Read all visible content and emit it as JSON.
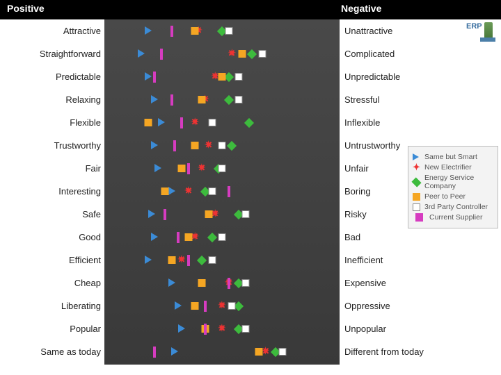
{
  "header": {
    "positive": "Positive",
    "negative": "Negative"
  },
  "logo": {
    "text": "ERP"
  },
  "axis_ticks": [
    "0.2",
    "0.3",
    "0.4",
    "0.5",
    "0.6",
    "0.7",
    "0.8"
  ],
  "legend": {
    "items": [
      {
        "key": "same_but_smart",
        "label": "Same but Smart"
      },
      {
        "key": "new_electrifier",
        "label": "New Electrifier"
      },
      {
        "key": "energy_service_company",
        "label": "Energy Service Company"
      },
      {
        "key": "peer_to_peer",
        "label": "Peer to Peer"
      },
      {
        "key": "third_party_controller",
        "label": "3rd Party Controller"
      },
      {
        "key": "current_supplier",
        "label": "Current Supplier"
      }
    ]
  },
  "chart_data": {
    "type": "scatter",
    "xlabel": "",
    "ylabel": "",
    "xlim": [
      0.15,
      0.85
    ],
    "series_keys": [
      "same_but_smart",
      "new_electrifier",
      "energy_service_company",
      "peer_to_peer",
      "third_party_controller",
      "current_supplier"
    ],
    "attributes": [
      {
        "pos": "Attractive",
        "neg": "Unattractive",
        "values": {
          "same_but_smart": 0.28,
          "new_electrifier": 0.43,
          "energy_service_company": 0.5,
          "peer_to_peer": 0.42,
          "third_party_controller": 0.52,
          "current_supplier": 0.35
        }
      },
      {
        "pos": "Straightforward",
        "neg": "Complicated",
        "values": {
          "same_but_smart": 0.26,
          "new_electrifier": 0.53,
          "energy_service_company": 0.59,
          "peer_to_peer": 0.56,
          "third_party_controller": 0.62,
          "current_supplier": 0.32
        }
      },
      {
        "pos": "Predictable",
        "neg": "Unpredictable",
        "values": {
          "same_but_smart": 0.28,
          "new_electrifier": 0.48,
          "energy_service_company": 0.52,
          "peer_to_peer": 0.5,
          "third_party_controller": 0.55,
          "current_supplier": 0.3
        }
      },
      {
        "pos": "Relaxing",
        "neg": "Stressful",
        "values": {
          "same_but_smart": 0.3,
          "new_electrifier": 0.45,
          "energy_service_company": 0.52,
          "peer_to_peer": 0.44,
          "third_party_controller": 0.55,
          "current_supplier": 0.35
        }
      },
      {
        "pos": "Flexible",
        "neg": "Inflexible",
        "values": {
          "same_but_smart": 0.32,
          "new_electrifier": 0.42,
          "energy_service_company": 0.58,
          "peer_to_peer": 0.28,
          "third_party_controller": 0.47,
          "current_supplier": 0.38
        }
      },
      {
        "pos": "Trustworthy",
        "neg": "Untrustworthy",
        "values": {
          "same_but_smart": 0.3,
          "new_electrifier": 0.46,
          "energy_service_company": 0.53,
          "peer_to_peer": 0.42,
          "third_party_controller": 0.5,
          "current_supplier": 0.36
        }
      },
      {
        "pos": "Fair",
        "neg": "Unfair",
        "values": {
          "same_but_smart": 0.31,
          "new_electrifier": 0.44,
          "energy_service_company": 0.49,
          "peer_to_peer": 0.38,
          "third_party_controller": 0.5,
          "current_supplier": 0.4
        }
      },
      {
        "pos": "Interesting",
        "neg": "Boring",
        "values": {
          "same_but_smart": 0.35,
          "new_electrifier": 0.4,
          "energy_service_company": 0.45,
          "peer_to_peer": 0.33,
          "third_party_controller": 0.47,
          "current_supplier": 0.52
        }
      },
      {
        "pos": "Safe",
        "neg": "Risky",
        "values": {
          "same_but_smart": 0.29,
          "new_electrifier": 0.48,
          "energy_service_company": 0.55,
          "peer_to_peer": 0.46,
          "third_party_controller": 0.57,
          "current_supplier": 0.33
        }
      },
      {
        "pos": "Good",
        "neg": "Bad",
        "values": {
          "same_but_smart": 0.3,
          "new_electrifier": 0.42,
          "energy_service_company": 0.47,
          "peer_to_peer": 0.4,
          "third_party_controller": 0.5,
          "current_supplier": 0.37
        }
      },
      {
        "pos": "Efficient",
        "neg": "Inefficient",
        "values": {
          "same_but_smart": 0.28,
          "new_electrifier": 0.38,
          "energy_service_company": 0.44,
          "peer_to_peer": 0.35,
          "third_party_controller": 0.47,
          "current_supplier": 0.4
        }
      },
      {
        "pos": "Cheap",
        "neg": "Expensive",
        "values": {
          "same_but_smart": 0.35,
          "new_electrifier": 0.52,
          "energy_service_company": 0.55,
          "peer_to_peer": 0.44,
          "third_party_controller": 0.57,
          "current_supplier": 0.52
        }
      },
      {
        "pos": "Liberating",
        "neg": "Oppressive",
        "values": {
          "same_but_smart": 0.37,
          "new_electrifier": 0.5,
          "energy_service_company": 0.55,
          "peer_to_peer": 0.42,
          "third_party_controller": 0.53,
          "current_supplier": 0.45
        }
      },
      {
        "pos": "Popular",
        "neg": "Unpopular",
        "values": {
          "same_but_smart": 0.38,
          "new_electrifier": 0.5,
          "energy_service_company": 0.55,
          "peer_to_peer": 0.45,
          "third_party_controller": 0.57,
          "current_supplier": 0.45
        }
      },
      {
        "pos": "Same as today",
        "neg": "Different from today",
        "values": {
          "same_but_smart": 0.36,
          "new_electrifier": 0.63,
          "energy_service_company": 0.66,
          "peer_to_peer": 0.61,
          "third_party_controller": 0.68,
          "current_supplier": 0.3
        }
      }
    ]
  }
}
